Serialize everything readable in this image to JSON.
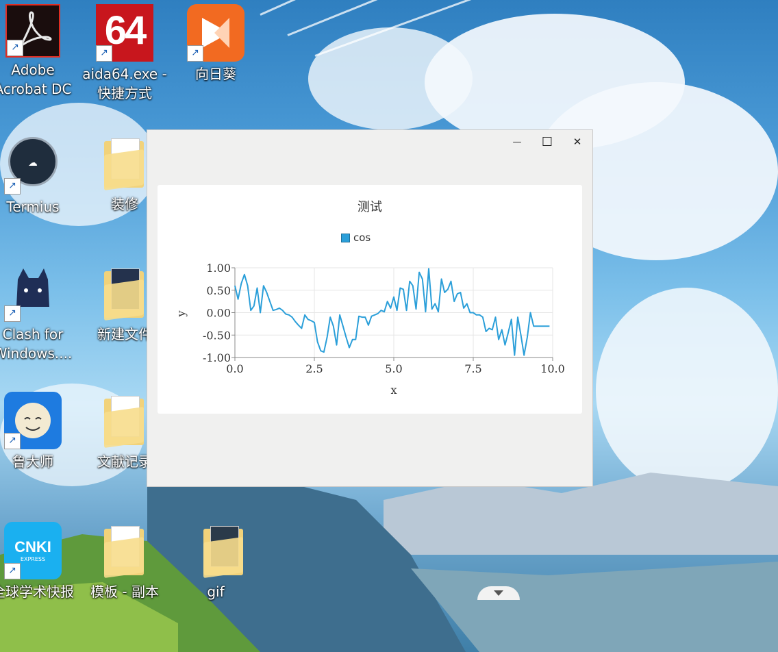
{
  "desktop": {
    "icons": [
      {
        "label": "Adobe\nAcrobat DC"
      },
      {
        "label": "aida64.exe -\n快捷方式"
      },
      {
        "label": "向日葵"
      },
      {
        "label": "Termius"
      },
      {
        "label": "装修"
      },
      {
        "label": "Clash for\nWindows...."
      },
      {
        "label": "新建文件"
      },
      {
        "label": "鲁大师"
      },
      {
        "label": "文献记录"
      },
      {
        "label": "全球学术快报"
      },
      {
        "label": "模板 - 副本"
      },
      {
        "label": "gif"
      }
    ],
    "aida_badge": "64",
    "cnki_badge": "CNKI",
    "cnki_sub": "EXPRESS"
  },
  "window": {
    "minimize_glyph": "—",
    "maximize_glyph": "☐",
    "close_glyph": "✕"
  },
  "chart_data": {
    "type": "line",
    "title": "测试",
    "xlabel": "x",
    "ylabel": "y",
    "xlim": [
      0,
      10
    ],
    "ylim": [
      -1,
      1
    ],
    "xticks": [
      "0.0",
      "2.5",
      "5.0",
      "7.5",
      "10.0"
    ],
    "yticks": [
      "1.00",
      "0.50",
      "0.00",
      "-0.50",
      "-1.00"
    ],
    "series": [
      {
        "name": "cos",
        "color": "#2b9fd9",
        "x": [
          0.0,
          0.1,
          0.2,
          0.3,
          0.4,
          0.5,
          0.6,
          0.7,
          0.8,
          0.9,
          1.0,
          1.1,
          1.2,
          1.3,
          1.4,
          1.5,
          1.6,
          1.7,
          1.8,
          1.9,
          2.0,
          2.1,
          2.2,
          2.3,
          2.4,
          2.5,
          2.6,
          2.7,
          2.8,
          2.9,
          3.0,
          3.1,
          3.2,
          3.3,
          3.4,
          3.5,
          3.6,
          3.7,
          3.8,
          3.9,
          4.0,
          4.1,
          4.2,
          4.3,
          4.4,
          4.5,
          4.6,
          4.7,
          4.8,
          4.9,
          5.0,
          5.1,
          5.2,
          5.3,
          5.4,
          5.5,
          5.6,
          5.7,
          5.8,
          5.9,
          6.0,
          6.1,
          6.2,
          6.3,
          6.4,
          6.5,
          6.6,
          6.7,
          6.8,
          6.9,
          7.0,
          7.1,
          7.2,
          7.3,
          7.4,
          7.5,
          7.6,
          7.7,
          7.8,
          7.9,
          8.0,
          8.1,
          8.2,
          8.3,
          8.4,
          8.5,
          8.6,
          8.7,
          8.8,
          8.9,
          9.0,
          9.1,
          9.2,
          9.3,
          9.4,
          9.5,
          9.6,
          9.7,
          9.8,
          9.9
        ],
        "y": [
          0.6,
          0.3,
          0.65,
          0.85,
          0.6,
          0.05,
          0.15,
          0.55,
          0.0,
          0.6,
          0.45,
          0.25,
          0.05,
          0.07,
          0.1,
          0.05,
          -0.03,
          -0.05,
          -0.1,
          -0.2,
          -0.28,
          -0.35,
          -0.05,
          -0.15,
          -0.18,
          -0.22,
          -0.65,
          -0.85,
          -0.88,
          -0.55,
          -0.1,
          -0.3,
          -0.72,
          -0.05,
          -0.3,
          -0.55,
          -0.78,
          -0.6,
          -0.6,
          -0.08,
          -0.1,
          -0.1,
          -0.28,
          -0.08,
          -0.05,
          -0.02,
          0.05,
          0.02,
          0.25,
          0.1,
          0.35,
          0.05,
          0.55,
          0.52,
          0.05,
          0.7,
          0.6,
          0.08,
          0.9,
          0.75,
          0.02,
          0.98,
          0.08,
          0.2,
          0.02,
          0.75,
          0.45,
          0.52,
          0.7,
          0.25,
          0.42,
          0.45,
          0.1,
          0.2,
          0.0,
          0.0,
          -0.05,
          -0.05,
          -0.1,
          -0.42,
          -0.35,
          -0.38,
          -0.1,
          -0.6,
          -0.38,
          -0.72,
          -0.45,
          -0.15,
          -0.95,
          -0.1,
          -0.5,
          -0.95,
          -0.55,
          0.0,
          -0.3,
          -0.3,
          -0.3,
          -0.3,
          -0.3,
          -0.3
        ]
      }
    ],
    "grid": true,
    "legend": "top-center"
  }
}
